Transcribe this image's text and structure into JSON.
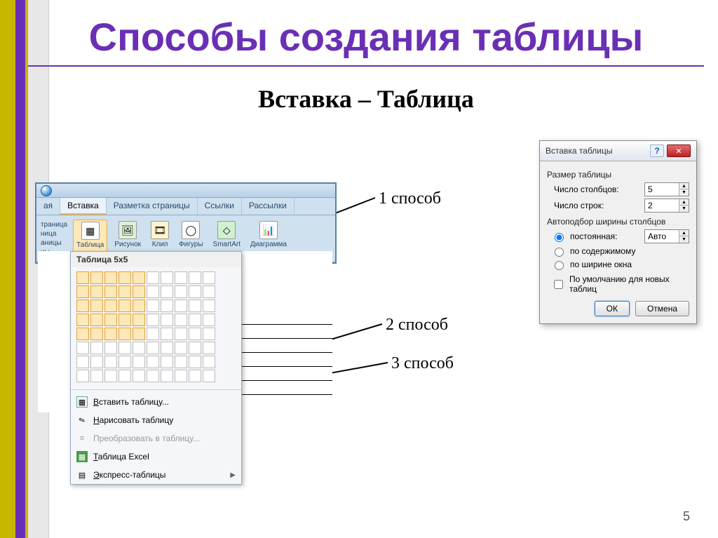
{
  "title": "Способы создания таблицы",
  "subtitle": "Вставка – Таблица",
  "page_number": "5",
  "labels": {
    "method1": "1 способ",
    "method2": "2 способ",
    "method3": "3 способ"
  },
  "word": {
    "tabs": [
      "ая",
      "Вставка",
      "Разметка страницы",
      "Ссылки",
      "Рассылки"
    ],
    "active_tab_index": 1,
    "left_cut": [
      "траница",
      "ница",
      "аницы",
      "цы"
    ],
    "ribbon": {
      "table": "Таблица",
      "picture": "Рисунок",
      "clip": "Клип",
      "shapes": "Фигуры",
      "smartart": "SmartArt",
      "chart": "Диаграмма"
    },
    "dropdown": {
      "heading": "Таблица 5x5",
      "grid_cols": 10,
      "grid_rows": 8,
      "selected_cols": 5,
      "selected_rows": 5,
      "items": [
        {
          "key": "insert",
          "label": "Вставить таблицу...",
          "underline": 0,
          "icon": "tbl",
          "disabled": false,
          "submenu": false
        },
        {
          "key": "draw",
          "label": "Нарисовать таблицу",
          "underline": 0,
          "icon": "pen",
          "disabled": false,
          "submenu": false
        },
        {
          "key": "convert",
          "label": "Преобразовать в таблицу...",
          "underline": -1,
          "icon": "conv",
          "disabled": true,
          "submenu": false
        },
        {
          "key": "excel",
          "label": "Таблица Excel",
          "underline": 0,
          "icon": "xls",
          "disabled": false,
          "submenu": false
        },
        {
          "key": "express",
          "label": "Экспресс-таблицы",
          "underline": 0,
          "icon": "exp",
          "disabled": false,
          "submenu": true
        }
      ]
    }
  },
  "dialog": {
    "title": "Вставка таблицы",
    "group_size": "Размер таблицы",
    "field_cols": "Число столбцов:",
    "field_rows": "Число строк:",
    "value_cols": "5",
    "value_rows": "2",
    "group_autofit": "Автоподбор ширины столбцов",
    "radio_fixed": "постоянная:",
    "radio_fixed_value": "Авто",
    "radio_content": "по содержимому",
    "radio_window": "по ширине окна",
    "selected_radio": "fixed",
    "checkbox_default": "По умолчанию для новых таблиц",
    "btn_ok": "ОК",
    "btn_cancel": "Отмена"
  }
}
